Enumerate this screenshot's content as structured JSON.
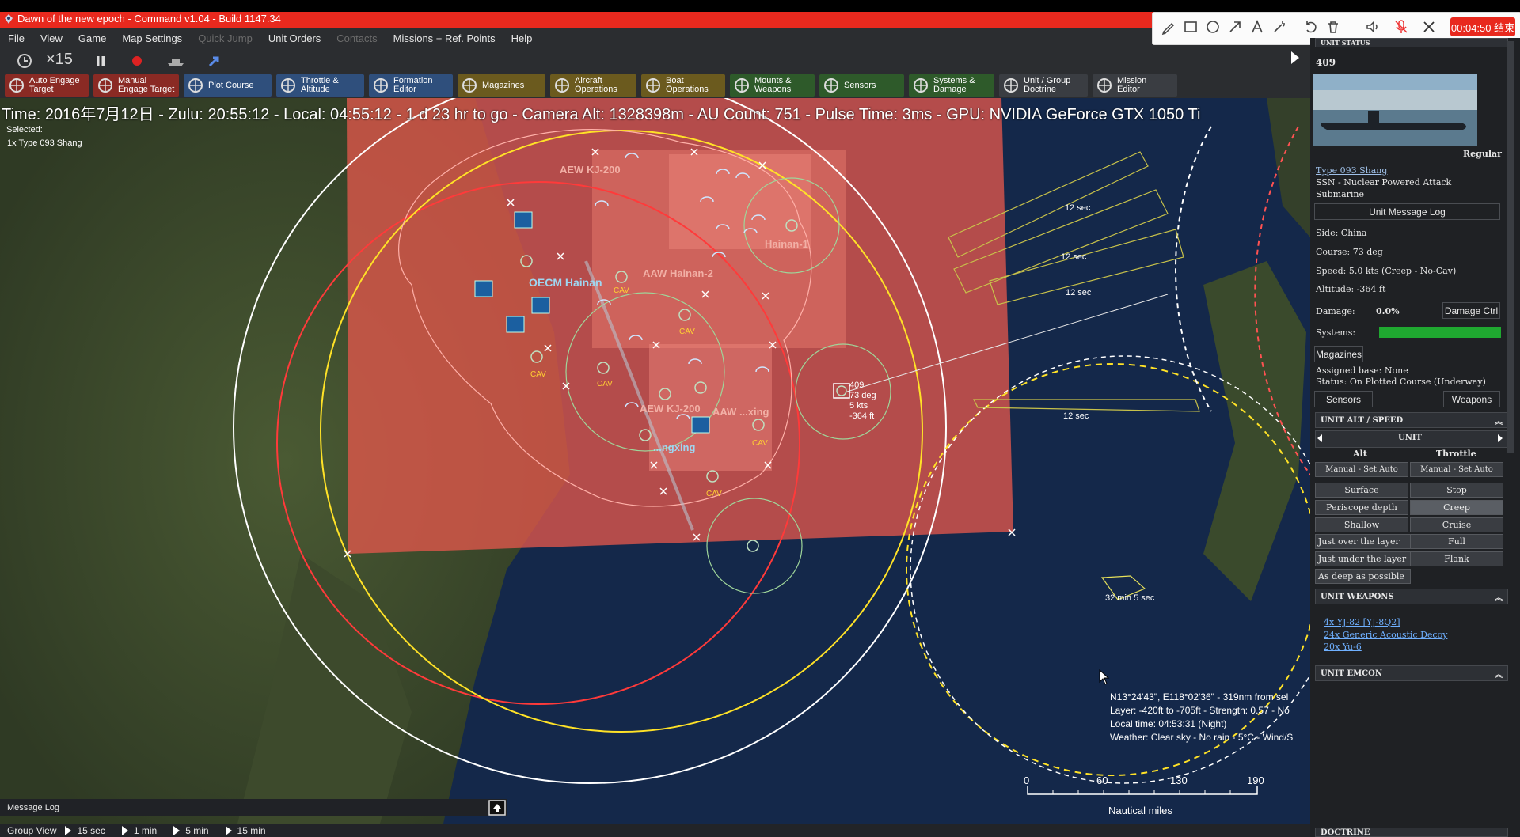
{
  "window": {
    "title": "Dawn of the new epoch - Command v1.04 - Build 1147.34"
  },
  "menu": {
    "items": [
      {
        "label": "File",
        "enabled": true
      },
      {
        "label": "View",
        "enabled": true
      },
      {
        "label": "Game",
        "enabled": true
      },
      {
        "label": "Map Settings",
        "enabled": true
      },
      {
        "label": "Quick Jump",
        "enabled": false
      },
      {
        "label": "Unit Orders",
        "enabled": true
      },
      {
        "label": "Contacts",
        "enabled": false
      },
      {
        "label": "Missions + Ref. Points",
        "enabled": true
      },
      {
        "label": "Help",
        "enabled": true
      }
    ]
  },
  "time_controls": {
    "speed": "×15"
  },
  "commands": [
    {
      "label": "Auto Engage\nTarget",
      "color": "#8a2a24"
    },
    {
      "label": "Manual\nEngage Target",
      "color": "#8a2a24"
    },
    {
      "label": "Plot Course",
      "color": "#2f4f7c"
    },
    {
      "label": "Throttle &\nAltitude",
      "color": "#2f4f7c"
    },
    {
      "label": "Formation\nEditor",
      "color": "#2f4f7c"
    },
    {
      "label": "Magazines",
      "color": "#6b5a1e"
    },
    {
      "label": "Aircraft\nOperations",
      "color": "#6b5a1e"
    },
    {
      "label": "Boat\nOperations",
      "color": "#6b5a1e"
    },
    {
      "label": "Mounts &\nWeapons",
      "color": "#2e5a2a"
    },
    {
      "label": "Sensors",
      "color": "#2e5a2a"
    },
    {
      "label": "Systems &\nDamage",
      "color": "#2e5a2a"
    },
    {
      "label": "Unit / Group\nDoctrine",
      "color": "#3a3d42"
    },
    {
      "label": "Mission\nEditor",
      "color": "#3a3d42"
    }
  ],
  "status": {
    "line": "Time: 2016年7月12日 - Zulu: 20:55:12 - Local: 04:55:12 - 1 d 23 hr to go -  Camera Alt: 1328398m  - AU Count: 751 - Pulse Time: 3ms - GPU: NVIDIA GeForce GTX 1050 Ti",
    "selected_label": "Selected:",
    "selected_value": "1x Type 093 Shang"
  },
  "map": {
    "labels": {
      "aew1": "AEW KJ-200",
      "ecm": "OECM Hainan",
      "aaw2": "AAW Hainan-2",
      "hainan1": "Hainan-1",
      "aew2": "AEW KJ-200",
      "aaw3": "AAW ...xing",
      "ngxing": "...ngxing"
    },
    "cav": "CAV",
    "unit_callout": {
      "id": "409",
      "course": "73 deg",
      "speed": "5 kts",
      "alt": "-364 ft"
    },
    "sec_labels": {
      "s1": "12 sec",
      "s2": "12 sec",
      "s3": "12 sec",
      "s4": "12 sec",
      "s5": "32 min 5 sec"
    },
    "hover_info": {
      "line1": "N13°24'43\", E118°02'36\" - 319nm from sel",
      "line2": "Layer: -420ft to -705ft - Strength: 0.57 - No",
      "line3": "Local time: 04:53:31 (Night)",
      "line4": "Weather: Clear sky - No rain - 5°C - Wind/S"
    },
    "scale": {
      "ticks": [
        "0",
        "60",
        "130",
        "190"
      ],
      "unit": "Nautical miles"
    }
  },
  "panel": {
    "status_header": "UNIT STATUS",
    "unit_name": "409",
    "proficiency": "Regular",
    "class_link": "Type 093 Shang",
    "type_line1": "SSN - Nuclear Powered Attack",
    "type_line2": "Submarine",
    "message_log_btn": "Unit Message Log",
    "side": "Side: China",
    "course": "Course: 73 deg",
    "speed": "Speed: 5.0 kts (Creep - No-Cav)",
    "altitude": "Altitude: -364 ft",
    "damage_label": "Damage:",
    "damage_value": "0.0%",
    "damage_ctrl_btn": "Damage Ctrl",
    "systems_label": "Systems:",
    "systems_health": 1.0,
    "magazines_btn": "Magazines",
    "assigned_base": "Assigned base: None",
    "status_line": "Status: On Plotted Course (Underway)",
    "sensors_btn": "Sensors",
    "weapons_btn": "Weapons",
    "alt_speed_header": "UNIT ALT / SPEED",
    "unit_selector": "UNIT",
    "alt_col": "Alt",
    "throttle_col": "Throttle",
    "alt_manual": "Manual - Set Auto",
    "thr_manual": "Manual - Set Auto",
    "alt_options": [
      "Surface",
      "Periscope depth",
      "Shallow",
      "Just over the layer",
      "Just under the layer",
      "As deep as possible"
    ],
    "thr_options": [
      "Stop",
      "Creep",
      "Cruise",
      "Full",
      "Flank"
    ],
    "weapons_header": "UNIT WEAPONS",
    "weapons": [
      "4x YJ-82 [YJ-8Q2]",
      "24x Generic Acoustic Decoy",
      "20x Yu-6"
    ],
    "emcon_header": "UNIT EMCON",
    "doctrine_header": "DOCTRINE"
  },
  "recording": {
    "timer": "00:04:50 结束"
  },
  "bottom": {
    "message_log": "Message Log",
    "group_view": "Group View",
    "steps": [
      "15 sec",
      "1 min",
      "5 min",
      "15 min"
    ]
  },
  "colors": {
    "title_red": "#e8291e",
    "zone_red": "#e2574c",
    "systems_green": "#1fa830"
  }
}
